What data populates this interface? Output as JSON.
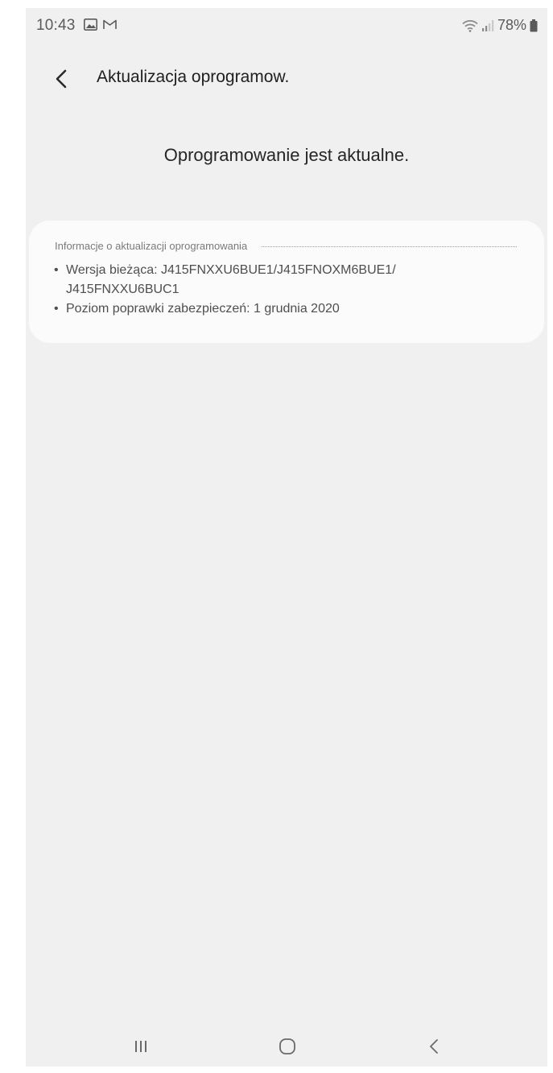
{
  "status_bar": {
    "time": "10:43",
    "battery_text": "78%",
    "icons": [
      "gallery-icon",
      "mail-icon",
      "wifi-icon",
      "signal-icon",
      "battery-icon"
    ]
  },
  "header": {
    "title": "Aktualizacja oprogramow.",
    "back_icon": "back-arrow-icon"
  },
  "main": {
    "status_message": "Oprogramowanie jest aktualne."
  },
  "info_card": {
    "header": "Informacje o aktualizacji oprogramowania",
    "items": [
      {
        "bullet": "•",
        "text": "Wersja bieżąca: J415FNXXU6BUE1/J415FNOXM6BUE1/ J415FNXXU6BUC1"
      },
      {
        "bullet": "•",
        "text": "Poziom poprawki zabezpieczeń: 1 grudnia 2020"
      }
    ]
  },
  "nav_bar": {
    "icons": [
      "recents-icon",
      "home-icon",
      "back-icon"
    ]
  },
  "colors": {
    "background": "#f0f0f0",
    "card": "#fbfbfb",
    "title_text": "#202020",
    "secondary_text": "#7a7a7a"
  }
}
